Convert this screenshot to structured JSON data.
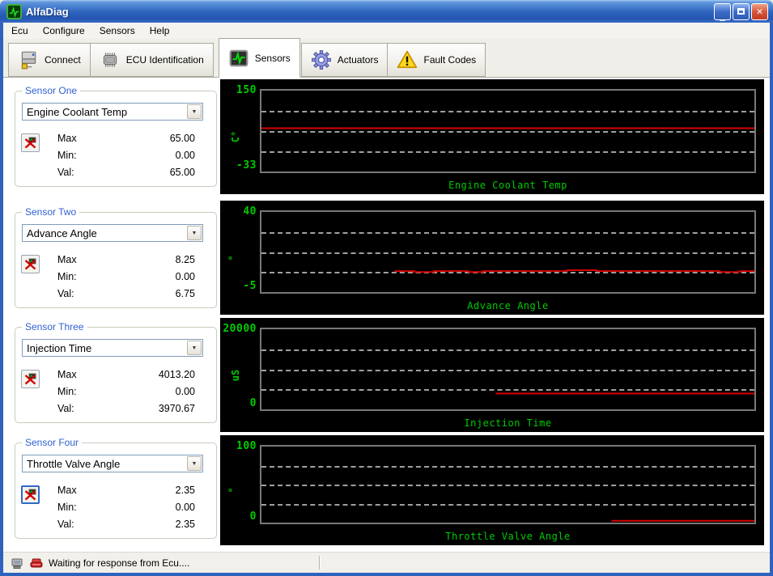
{
  "window": {
    "title": "AlfaDiag"
  },
  "menu": {
    "items": [
      "Ecu",
      "Configure",
      "Sensors",
      "Help"
    ]
  },
  "toolbar": {
    "tabs": [
      {
        "label": "Connect",
        "icon": "connect-icon"
      },
      {
        "label": "ECU Identification",
        "icon": "chip-icon"
      },
      {
        "label": "Sensors",
        "icon": "oscilloscope-icon",
        "active": true
      },
      {
        "label": "Actuators",
        "icon": "gear-icon"
      },
      {
        "label": "Fault Codes",
        "icon": "warning-icon"
      }
    ]
  },
  "field_labels": {
    "max": "Max",
    "min": "Min:",
    "val": "Val:"
  },
  "sensors": [
    {
      "group": "Sensor One",
      "selected": "Engine Coolant Temp",
      "max": "65.00",
      "min": "0.00",
      "val": "65.00"
    },
    {
      "group": "Sensor Two",
      "selected": "Advance Angle",
      "max": "8.25",
      "min": "0.00",
      "val": "6.75"
    },
    {
      "group": "Sensor Three",
      "selected": "Injection Time",
      "max": "4013.20",
      "min": "0.00",
      "val": "3970.67"
    },
    {
      "group": "Sensor Four",
      "selected": "Throttle Valve Angle",
      "max": "2.35",
      "min": "0.00",
      "val": "2.35"
    }
  ],
  "statusbar": {
    "message": "Waiting for response from Ecu...."
  },
  "colors": {
    "chart_green": "#00CC00",
    "series_red": "#D80000",
    "titlebar_blue": "#2E62BC",
    "groupbox_legend_blue": "#3060D0"
  },
  "chart_data": [
    {
      "type": "line",
      "title": "Engine Coolant Temp",
      "unit": "C°",
      "ylim": [
        -33,
        150
      ],
      "ymax_label": "150",
      "ymin_label": "-33",
      "x_axis": "unlabeled time sweep, x values are percent of plot width",
      "grid": "3 dashed gray horizontal lines at quarter intervals",
      "legend_position": "none",
      "series": [
        {
          "name": "Engine Coolant Temp",
          "color": "#D80000",
          "points": [
            [
              0,
              65
            ],
            [
              100,
              65
            ]
          ]
        }
      ]
    },
    {
      "type": "line",
      "title": "Advance Angle",
      "unit": "°",
      "ylim": [
        -5,
        40
      ],
      "ymax_label": "40",
      "ymin_label": "-5",
      "x_axis": "unlabeled time sweep, x values are percent of plot width",
      "grid": "3 dashed gray horizontal lines at quarter intervals",
      "legend_position": "none",
      "series": [
        {
          "name": "Advance Angle",
          "color": "#D80000",
          "points": [
            [
              27,
              6.75
            ],
            [
              31,
              6.75
            ],
            [
              31,
              6.25
            ],
            [
              35,
              6.25
            ],
            [
              35,
              6.75
            ],
            [
              42,
              6.75
            ],
            [
              42,
              6.25
            ],
            [
              45,
              6.25
            ],
            [
              45,
              6.75
            ],
            [
              62,
              6.75
            ],
            [
              62,
              7.3
            ],
            [
              68,
              7.3
            ],
            [
              68,
              6.75
            ],
            [
              93,
              6.75
            ],
            [
              93,
              6.25
            ],
            [
              97,
              6.25
            ],
            [
              97,
              6.75
            ],
            [
              100,
              6.75
            ]
          ]
        }
      ]
    },
    {
      "type": "line",
      "title": "Injection Time",
      "unit": "uS",
      "ylim": [
        0,
        20000
      ],
      "ymax_label": "20000",
      "ymin_label": "0",
      "x_axis": "unlabeled time sweep, x values are percent of plot width",
      "grid": "3 dashed gray horizontal lines at quarter intervals",
      "legend_position": "none",
      "series": [
        {
          "name": "Injection Time",
          "color": "#D80000",
          "points": [
            [
              47.5,
              3970.67
            ],
            [
              100,
              3970.67
            ]
          ]
        }
      ]
    },
    {
      "type": "line",
      "title": "Throttle Valve Angle",
      "unit": "°",
      "ylim": [
        0,
        100
      ],
      "ymax_label": "100",
      "ymin_label": "0",
      "x_axis": "unlabeled time sweep, x values are percent of plot width",
      "grid": "3 dashed gray horizontal lines at quarter intervals",
      "legend_position": "none",
      "series": [
        {
          "name": "Throttle Valve Angle",
          "color": "#D80000",
          "points": [
            [
              71,
              2.35
            ],
            [
              100,
              2.35
            ]
          ]
        }
      ]
    }
  ]
}
